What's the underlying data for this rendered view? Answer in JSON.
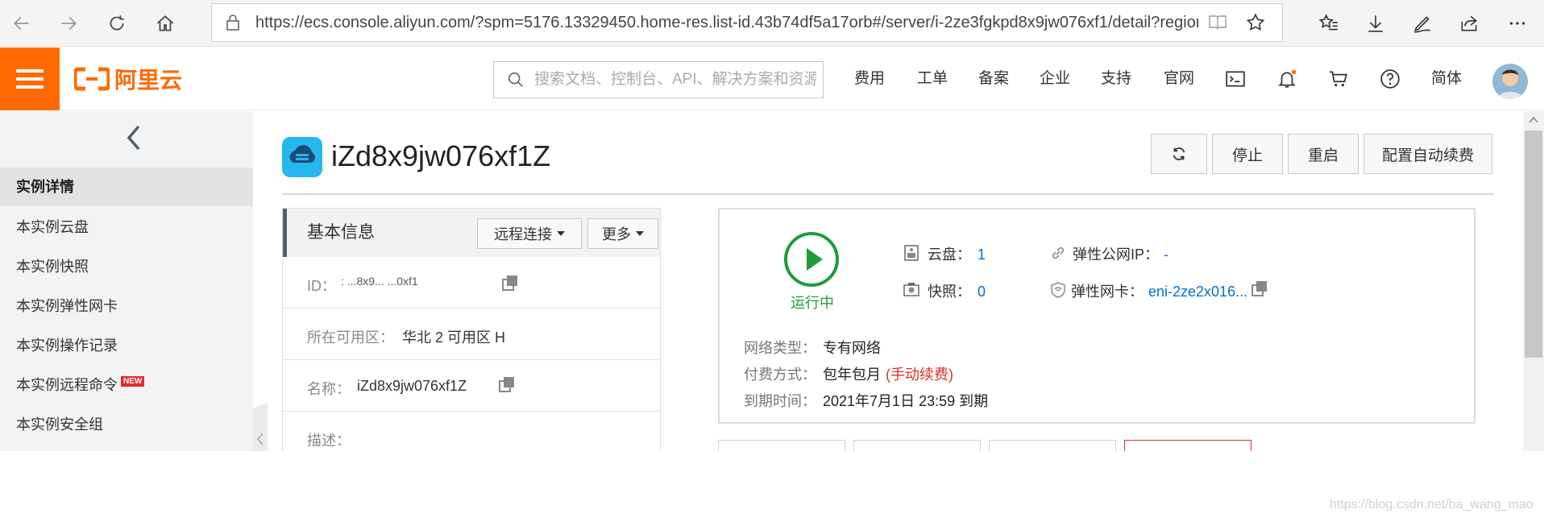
{
  "browser": {
    "url": "https://ecs.console.aliyun.com/?spm=5176.13329450.home-res.list-id.43b74df5a17orb#/server/i-2ze3fgkpd8x9jw076xf1/detail?regionId=cn"
  },
  "header": {
    "logo_text": "阿里云",
    "search_placeholder": "搜索文档、控制台、API、解决方案和资源",
    "nav": [
      "费用",
      "工单",
      "备案",
      "企业",
      "支持",
      "官网"
    ],
    "lang": "简体",
    "accent_color": "#ff6a00"
  },
  "sidebar": {
    "items": [
      {
        "label": "实例详情",
        "active": true
      },
      {
        "label": "本实例云盘"
      },
      {
        "label": "本实例快照"
      },
      {
        "label": "本实例弹性网卡"
      },
      {
        "label": "本实例操作记录"
      },
      {
        "label": "本实例远程命令",
        "badge": "NEW"
      },
      {
        "label": "本实例安全组"
      }
    ]
  },
  "main": {
    "title": "iZd8x9jw076xf1Z",
    "actions": {
      "stop": "停止",
      "restart": "重启",
      "auto_renew": "配置自动续费"
    },
    "basic": {
      "heading": "基本信息",
      "remote_btn": "远程连接",
      "more_btn": "更多",
      "rows": [
        {
          "key": "ID：",
          "value": ":      ...8x9...   ...0xf1"
        },
        {
          "key": "所在可用区：",
          "value": "华北 2 可用区 H"
        },
        {
          "key": "名称：",
          "value": "iZd8x9jw076xf1Z"
        },
        {
          "key": "描述：",
          "value": ""
        }
      ]
    },
    "status": {
      "state": "运行中",
      "state_color": "#1e9c3a",
      "disk_label": "云盘：",
      "disk_value": "1",
      "snapshot_label": "快照：",
      "snapshot_value": "0",
      "eip_label": "弹性公网IP：",
      "eip_value": "-",
      "eni_label": "弹性网卡：",
      "eni_value": "eni-2ze2x016...",
      "network_key": "网络类型：",
      "network_value": "专有网络",
      "billing_key": "付费方式：",
      "billing_value": "包年包月",
      "billing_note": "(手动续费)",
      "expire_key": "到期时间：",
      "expire_value": "2021年7月1日 23:59 到期"
    }
  },
  "watermark": "https://blog.csdn.net/ba_wang_mao"
}
